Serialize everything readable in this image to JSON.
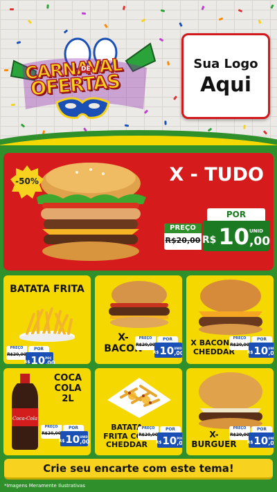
{
  "header": {
    "title_line1": "CARNAVAL",
    "title_de": "DE",
    "title_line2": "OFERTAS",
    "logo_line1": "Sua Logo",
    "logo_line2": "Aqui"
  },
  "featured": {
    "badge": "-50%",
    "name": "X - TUDO",
    "preco_label": "PREÇO",
    "old_price": "R$20,00",
    "por_label": "POR",
    "currency": "R$",
    "price_int": "10",
    "price_cents": ",00",
    "unit": "UNID"
  },
  "products": [
    {
      "name": "BATATA FRITA",
      "preco_label": "PREÇO",
      "old_price": "R$20,00",
      "por_label": "POR",
      "currency": "R$",
      "price_int": "10",
      "price_cents": ",00",
      "unit": "POÇ"
    },
    {
      "name": "X-\nBACON",
      "preco_label": "PREÇO",
      "old_price": "R$20,00",
      "por_label": "POR",
      "currency": "R$",
      "price_int": "10",
      "price_cents": ",00",
      "unit": "UNID"
    },
    {
      "name": "X BACON E\nCHEDDAR",
      "preco_label": "PREÇO",
      "old_price": "R$20,00",
      "por_label": "POR",
      "currency": "R$",
      "price_int": "10",
      "price_cents": ",00",
      "unit": "UNID"
    },
    {
      "name": "COCA\nCOLA\n2L",
      "preco_label": "PREÇO",
      "old_price": "R$20,00",
      "por_label": "POR",
      "currency": "R$",
      "price_int": "10",
      "price_cents": ",00",
      "unit": "UNID"
    },
    {
      "name": "BATATA\nFRITA COM\nCHEDDAR",
      "preco_label": "PREÇO",
      "old_price": "R$20,00",
      "por_label": "POR",
      "currency": "R$",
      "price_int": "10",
      "price_cents": ",00",
      "unit": "POÇ"
    },
    {
      "name": "X-\nBURGUER",
      "preco_label": "PREÇO",
      "old_price": "R$20,00",
      "por_label": "POR",
      "currency": "R$",
      "price_int": "10",
      "price_cents": ",00",
      "unit": "UNID"
    }
  ],
  "cta": "Crie seu encarte com este tema!",
  "disclaimer": "*Imagens Meramente Ilustrativas",
  "colors": {
    "red": "#d51b1b",
    "yellow": "#f5d800",
    "green": "#2f8f2a",
    "blue": "#1a4fb5"
  }
}
